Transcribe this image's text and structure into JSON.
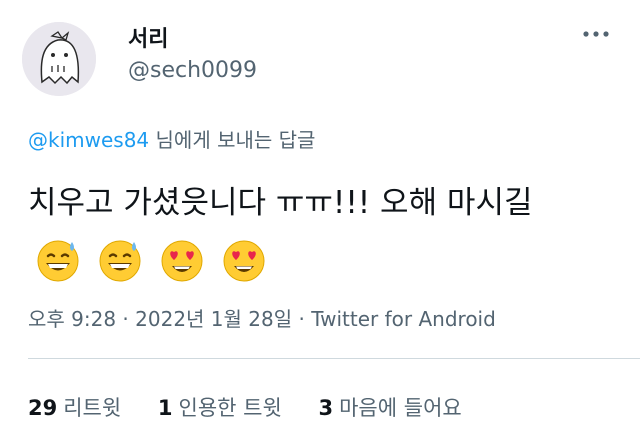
{
  "author": {
    "display_name": "서리",
    "handle": "@sech0099",
    "avatar_icon": "ghost-doodle-avatar"
  },
  "more_icon": "more-horizontal-icon",
  "reply_context": {
    "mention": "@kimwes84",
    "suffix": " 님에게 보내는 답글"
  },
  "tweet": {
    "text": "치우고 가셨읏니다 ㅠㅠ!!! 오해 마시길",
    "emojis": [
      {
        "icon": "grinning-face-with-sweat-icon"
      },
      {
        "icon": "grinning-face-with-sweat-icon"
      },
      {
        "icon": "smiling-face-with-heart-eyes-icon"
      },
      {
        "icon": "smiling-face-with-heart-eyes-icon"
      }
    ]
  },
  "meta": {
    "time": "오후 9:28",
    "sep1": " · ",
    "date": "2022년 1월 28일",
    "sep2": " · ",
    "source": "Twitter for Android"
  },
  "stats": {
    "retweets_count": "29",
    "retweets_label": "리트윗",
    "quotes_count": "1",
    "quotes_label": "인용한 트윗",
    "likes_count": "3",
    "likes_label": "마음에 들어요"
  },
  "colors": {
    "text_primary": "#0f1419",
    "text_secondary": "#536471",
    "link": "#1d9bf0",
    "divider": "#cfd9de"
  }
}
